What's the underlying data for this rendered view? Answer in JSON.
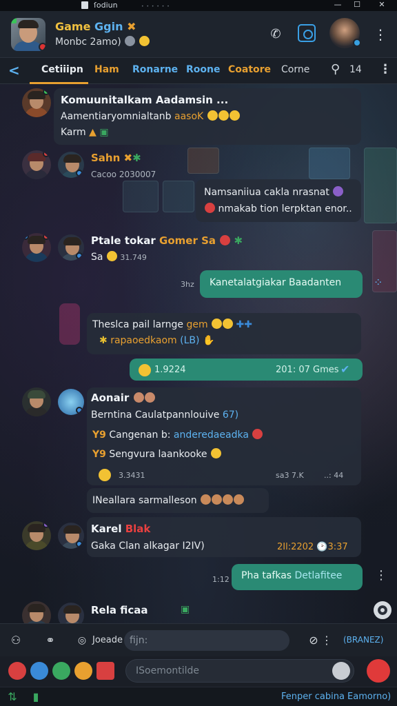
{
  "window": {
    "title": "ſodiun",
    "controls": [
      "—",
      "☐",
      "✕"
    ]
  },
  "header": {
    "title_part1": "Game",
    "title_part2": "Ggin",
    "subtitle": "Monbc 2amo)",
    "menu_icon": "more-vertical-icon"
  },
  "tabs": {
    "back": "<",
    "items": [
      {
        "label": "Cetiiipn",
        "color": "#e8f0f8"
      },
      {
        "label": "Ham",
        "color": "#e8a030"
      },
      {
        "label": "Ronarne",
        "color": "#5db2f0"
      },
      {
        "label": "Roone",
        "color": "#5db2f0"
      },
      {
        "label": "Coatore",
        "color": "#e8a030"
      },
      {
        "label": "Corne",
        "color": "#d0d6dc"
      }
    ],
    "search_count": "14"
  },
  "messages": {
    "m1": {
      "name": "Komuunitalkam Aadamsin ...",
      "line1": "Aamentiaryomnialtanb",
      "line1_hl": "aasoK",
      "line2": "Karm"
    },
    "m2": {
      "name": "Sahn",
      "time": "Cacoo 2030007"
    },
    "m3": {
      "line1": "Namsaniiua cakla nrasnat",
      "line2": "nmakab tion lerpktan enor.."
    },
    "m4": {
      "name": "Ptale tokar",
      "name_hl": "Gomer Sa",
      "sub": "Sa",
      "time": "31.749"
    },
    "m5": {
      "time": "3hz",
      "text": "Kanetalatgiakar Baadanten"
    },
    "m6": {
      "line1": "Theslca pail larnge",
      "line1_hl": "gem",
      "line2": "rapaoedkaom",
      "line2_hl": "(LB)"
    },
    "m7": {
      "time_left": "1.9224",
      "time_right": "201: 07 Gmes"
    },
    "m8": {
      "name": "Aonair",
      "line1": "Berntina Caulatpannlouive",
      "line1_hl": "67)",
      "line2_prefix": "Y9",
      "line2": "Cangenan b:",
      "line2_hl": "anderedaeadka",
      "line3_prefix": "Y9",
      "line3": "Sengvura laankooke",
      "time_left": "3.3431",
      "time_mid": "sa3 7.K",
      "time_right": "..: 44"
    },
    "m9": {
      "text": "INeallara sarmalleson"
    },
    "m10": {
      "name": "Karel",
      "name_hl": "Blak",
      "line1": "Gaka Clan alkagar I2IV)",
      "time": "2Il:2202 🕑3:37"
    },
    "m11": {
      "time": "1:12",
      "text_part1": "Pha tafkas",
      "text_part2": "Detlafitee"
    },
    "m12": {
      "name": "Rela ficaa"
    }
  },
  "composer": {
    "label": "Joeade",
    "placeholder": "fijn:",
    "right_link": "(BRANEZ)",
    "message_placeholder": "ISoemontilde"
  },
  "statusbar": {
    "text": "Fenper cabina Eamorno)"
  },
  "colors": {
    "accent_orange": "#e8a030",
    "accent_blue": "#5db2f0",
    "outgoing_bubble": "#2a8a74"
  }
}
